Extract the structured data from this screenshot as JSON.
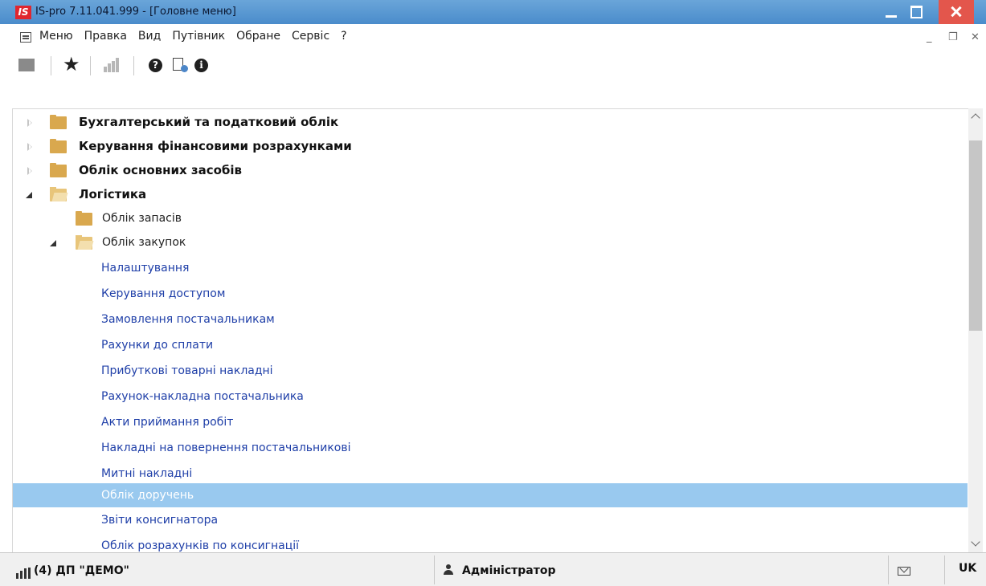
{
  "window": {
    "logo": "IS",
    "title": "IS-pro 7.11.041.999 - [Головне меню]"
  },
  "menu": {
    "items": [
      "Меню",
      "Правка",
      "Вид",
      "Путівник",
      "Обране",
      "Сервіс",
      "?"
    ]
  },
  "toolbar": {
    "icons": [
      "folder-icon",
      "star-icon",
      "chart-icon",
      "help-icon",
      "document-icon",
      "info-icon"
    ]
  },
  "tree": {
    "items": [
      {
        "label": "Бухгалтерський та податковий облік",
        "level": 0,
        "state": "collapsed"
      },
      {
        "label": "Керування фінансовими розрахунками",
        "level": 0,
        "state": "collapsed"
      },
      {
        "label": "Облік основних засобів",
        "level": 0,
        "state": "collapsed"
      },
      {
        "label": "Логістика",
        "level": 0,
        "state": "expanded"
      },
      {
        "label": "Облік запасів",
        "level": 1,
        "state": "collapsed"
      },
      {
        "label": "Облік закупок",
        "level": 1,
        "state": "expanded"
      },
      {
        "label": "Налаштування",
        "level": 2,
        "state": "leaf"
      },
      {
        "label": "Керування доступом",
        "level": 2,
        "state": "leaf"
      },
      {
        "label": "Замовлення постачальникам",
        "level": 2,
        "state": "leaf"
      },
      {
        "label": "Рахунки до сплати",
        "level": 2,
        "state": "leaf"
      },
      {
        "label": "Прибуткові товарні накладні",
        "level": 2,
        "state": "leaf"
      },
      {
        "label": "Рахунок-накладна постачальника",
        "level": 2,
        "state": "leaf"
      },
      {
        "label": "Акти приймання робіт",
        "level": 2,
        "state": "leaf"
      },
      {
        "label": "Накладні на повернення постачальникові",
        "level": 2,
        "state": "leaf"
      },
      {
        "label": "Митні накладні",
        "level": 2,
        "state": "leaf"
      },
      {
        "label": "Облік доручень",
        "level": 2,
        "state": "leaf",
        "selected": true
      },
      {
        "label": "Звіти консигнатора",
        "level": 2,
        "state": "leaf"
      },
      {
        "label": "Облік розрахунків по консигнації",
        "level": 2,
        "state": "leaf"
      }
    ]
  },
  "status": {
    "organization": "(4) ДП \"ДЕМО\"",
    "user": "Адміністратор",
    "language": "UK"
  },
  "colors": {
    "title_bar": "#4a8ccb",
    "close_button": "#e3564c",
    "selection": "#99c9ef",
    "leaf_link": "#1f3fa8",
    "folder": "#d9a84e"
  }
}
